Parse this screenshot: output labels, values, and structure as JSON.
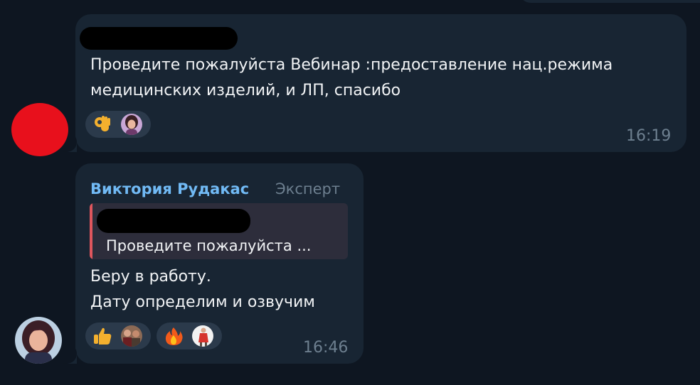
{
  "messages": [
    {
      "text_line1": "Проведите пожалуйста Вебинар :предоставление нац.режима",
      "text_line2": "медицинских изделий, и ЛП, спасибо",
      "time": "16:19",
      "avatar_color": "#e8101c",
      "reactions": [
        {
          "emoji": "ok-hand-icon",
          "reactor": "avatar-woman-purple"
        }
      ]
    },
    {
      "sender": "Виктория Рудакас",
      "role": "Эксперт",
      "reply_preview": "Проведите пожалуйста ...",
      "text_line1": "Беру в работу.",
      "text_line2": "Дату определим и озвучим",
      "time": "16:46",
      "reactions": [
        {
          "emoji": "thumbs-up-icon",
          "reactor": "avatar-people-brown"
        },
        {
          "emoji": "fire-icon",
          "reactor": "avatar-person-red"
        }
      ]
    }
  ],
  "colors": {
    "background": "#0e1621",
    "bubble": "#182533",
    "sender_name": "#71baf5",
    "reply_bar": "#e0565d",
    "muted": "#6d7f8f"
  }
}
